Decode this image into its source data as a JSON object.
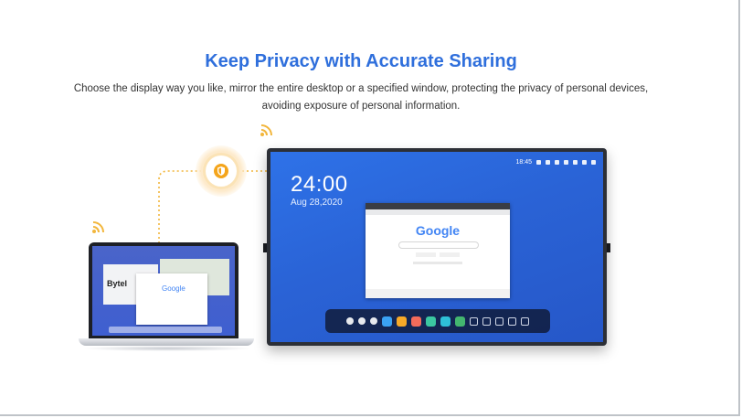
{
  "header": {
    "title": "Keep Privacy with Accurate Sharing",
    "subtitle": "Choose the display way you like, mirror the entire desktop or a specified window, protecting the privacy of personal devices, avoiding exposure of personal information."
  },
  "laptop": {
    "window_label": "Bytel",
    "search_brand": "Google"
  },
  "panel": {
    "time": "24:00",
    "date": "Aug 28,2020",
    "status_time": "18:45",
    "browser_brand": "Google"
  },
  "icons": {
    "wifi": "wifi-signal-icon",
    "shield": "shield-icon"
  },
  "colors": {
    "accent": "#2f6fdc",
    "wifi": "#f2b63c",
    "panel_blue": "#2a63d6"
  }
}
